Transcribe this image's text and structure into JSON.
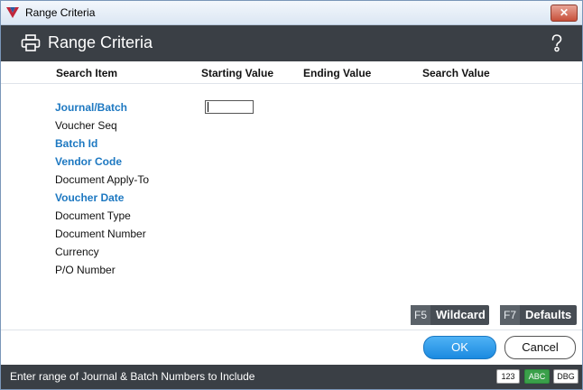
{
  "window": {
    "title": "Range Criteria",
    "close_label": "✕"
  },
  "header": {
    "title": "Range Criteria"
  },
  "columns": {
    "search_item": "Search Item",
    "starting_value": "Starting Value",
    "ending_value": "Ending Value",
    "search_value": "Search Value"
  },
  "items": [
    {
      "label": "Journal/Batch",
      "required": true
    },
    {
      "label": "Voucher Seq",
      "required": false
    },
    {
      "label": "Batch Id",
      "required": true
    },
    {
      "label": "Vendor Code",
      "required": true
    },
    {
      "label": "Document Apply-To",
      "required": false
    },
    {
      "label": "Voucher Date",
      "required": true
    },
    {
      "label": "Document Type",
      "required": false
    },
    {
      "label": "Document Number",
      "required": false
    },
    {
      "label": "Currency",
      "required": false
    },
    {
      "label": "P/O Number",
      "required": false
    }
  ],
  "fields": {
    "journal_batch_start": ""
  },
  "fkeys": {
    "wildcard": {
      "key": "F5",
      "label": "Wildcard"
    },
    "defaults": {
      "key": "F7",
      "label": "Defaults"
    }
  },
  "buttons": {
    "ok": "OK",
    "cancel": "Cancel"
  },
  "status": {
    "text": "Enter range of Journal & Batch Numbers to Include",
    "badges": [
      "123",
      "ABC",
      "DBG"
    ]
  },
  "colors": {
    "accent": "#1d78c1",
    "header_bg": "#3a3f45",
    "ok_blue": "#1b8ae0",
    "abc_green": "#3aa04a"
  }
}
